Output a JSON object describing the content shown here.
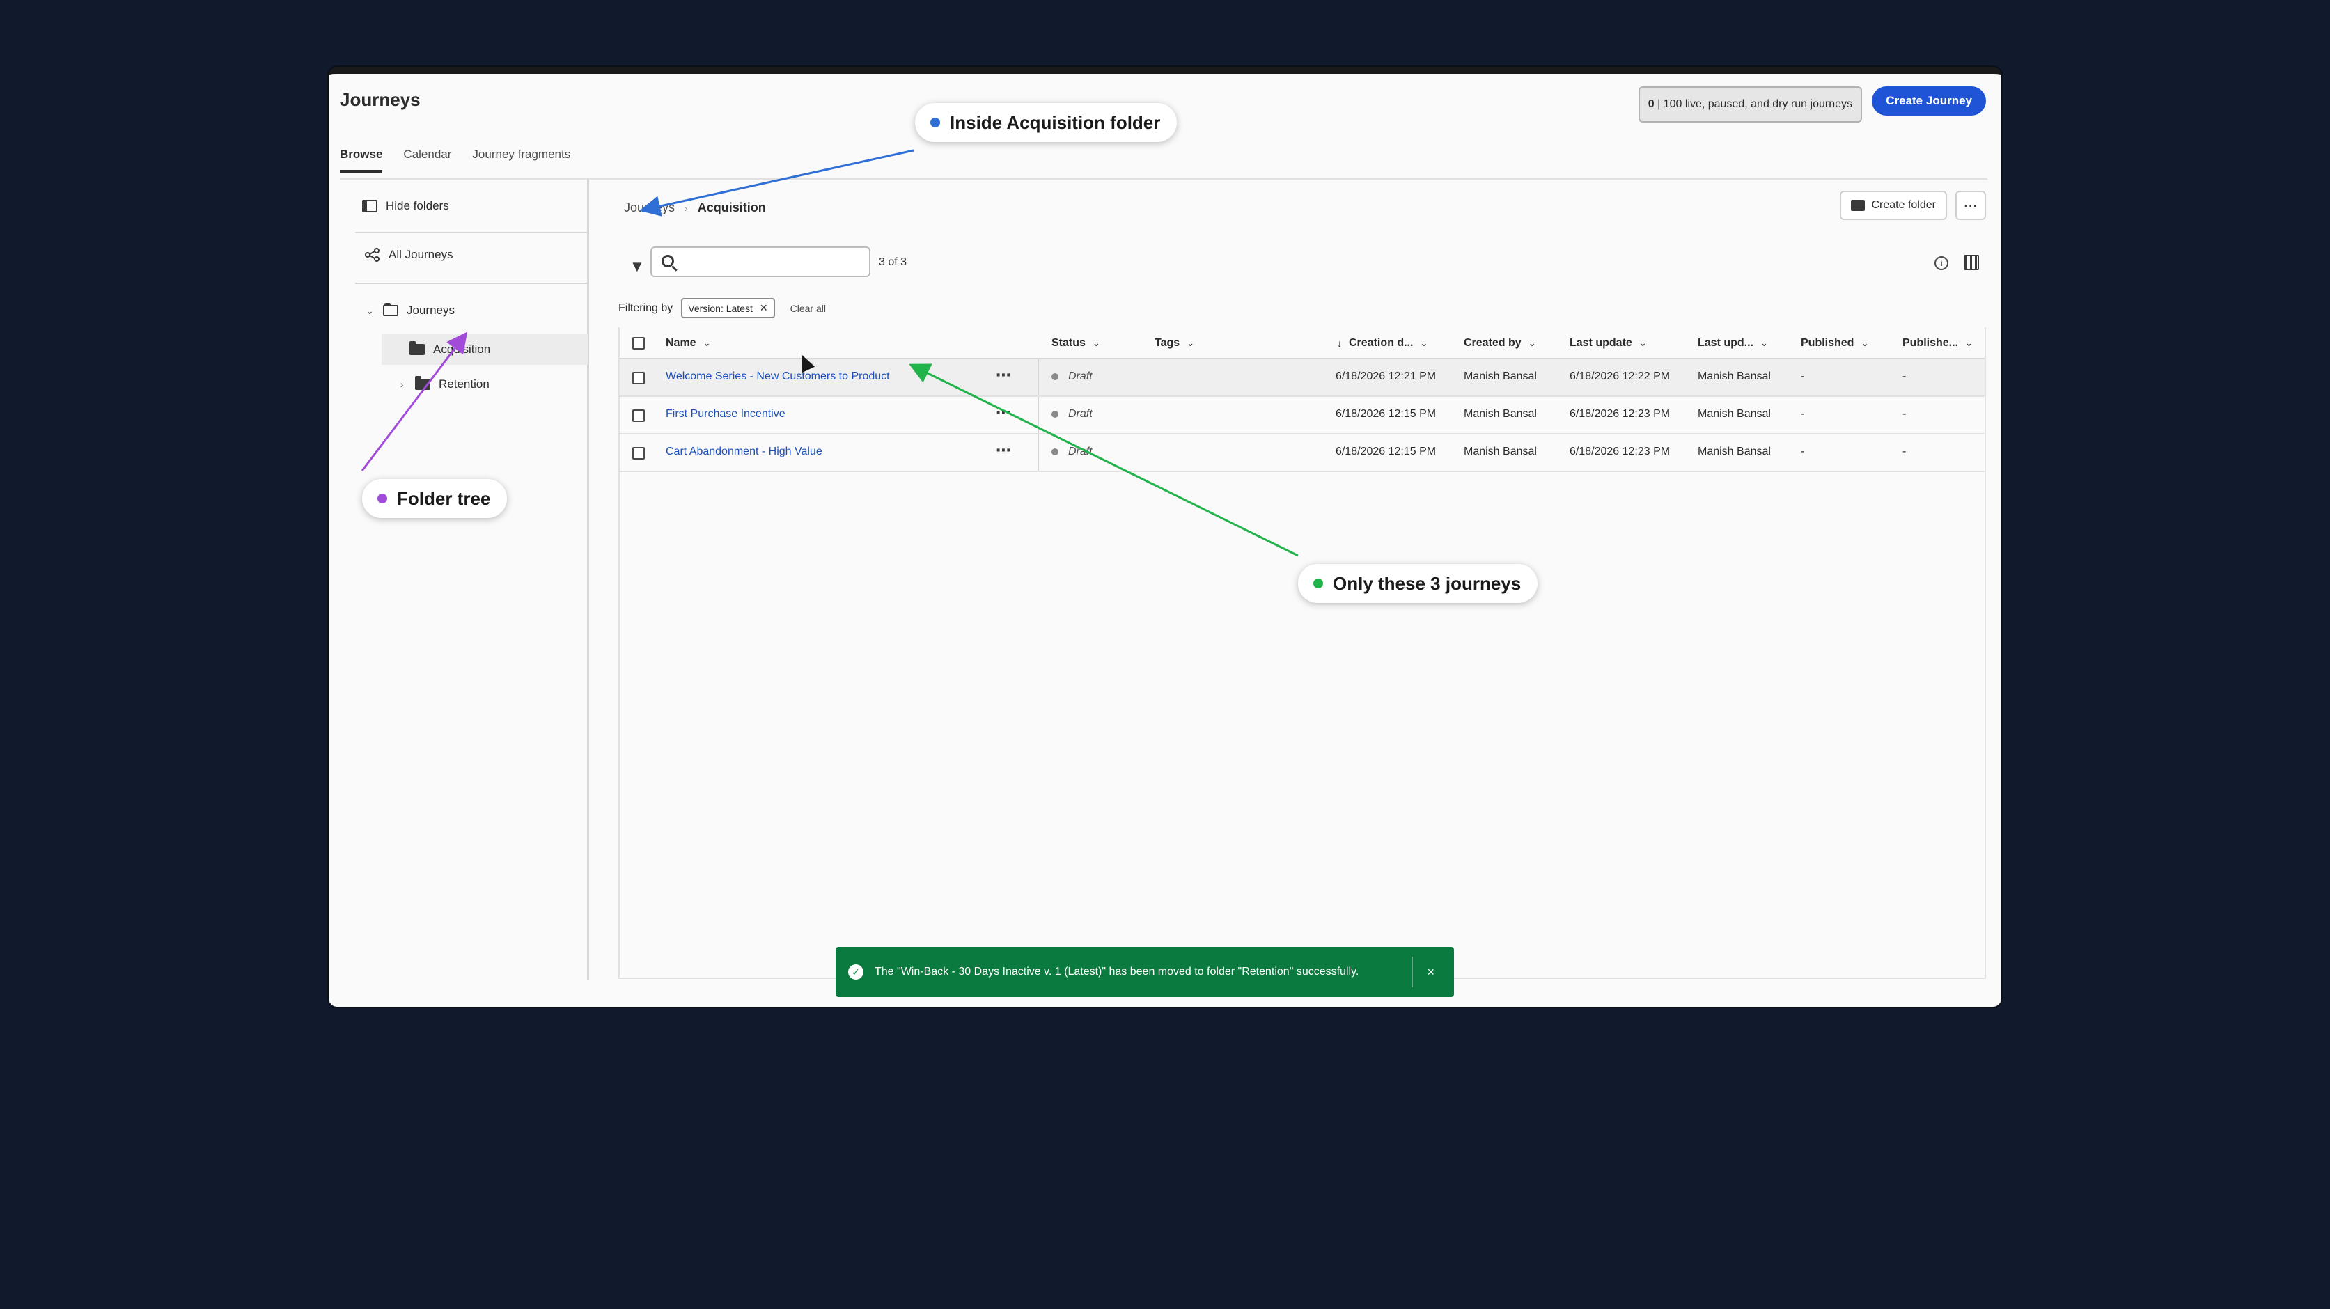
{
  "app": {
    "title": "Journeys"
  },
  "tabs": [
    {
      "label": "Browse",
      "active": true
    },
    {
      "label": "Calendar",
      "active": false
    },
    {
      "label": "Journey fragments",
      "active": false
    }
  ],
  "header": {
    "quota_count": "0",
    "quota_text": " | 100 live, paused, and dry run journeys",
    "create_journey_label": "Create Journey"
  },
  "sidebar": {
    "hide_folders_label": "Hide folders",
    "all_journeys_label": "All Journeys",
    "tree": [
      {
        "label": "Journeys",
        "expanded": true
      },
      {
        "label": "Acquisition",
        "selected": true
      },
      {
        "label": "Retention",
        "expanded": false
      }
    ]
  },
  "main": {
    "breadcrumb": [
      "Journeys",
      "Acquisition"
    ],
    "create_folder_label": "Create folder",
    "search_placeholder": "",
    "count": "3 of 3",
    "filtering_label": "Filtering by",
    "filter_chip": "Version: Latest",
    "clear_all_label": "Clear all"
  },
  "table": {
    "columns": [
      "Name",
      "Status",
      "Tags",
      "Creation d...",
      "Created by",
      "Last update",
      "Last upd...",
      "Published",
      "Publishe..."
    ],
    "rows": [
      {
        "name": "Welcome Series - New Customers to Product",
        "status": "Draft",
        "tags": "",
        "creation": "6/18/2026 12:21 PM",
        "created_by": "Manish Bansal",
        "last_update": "6/18/2026 12:22 PM",
        "last_updated_by": "Manish Bansal",
        "published": "-",
        "published_by": "-"
      },
      {
        "name": "First Purchase Incentive",
        "status": "Draft",
        "tags": "",
        "creation": "6/18/2026 12:15 PM",
        "created_by": "Manish Bansal",
        "last_update": "6/18/2026 12:23 PM",
        "last_updated_by": "Manish Bansal",
        "published": "-",
        "published_by": "-"
      },
      {
        "name": "Cart Abandonment - High Value",
        "status": "Draft",
        "tags": "",
        "creation": "6/18/2026 12:15 PM",
        "created_by": "Manish Bansal",
        "last_update": "6/18/2026 12:23 PM",
        "last_updated_by": "Manish Bansal",
        "published": "-",
        "published_by": "-"
      }
    ]
  },
  "toast": {
    "message": "The \"Win-Back - 30 Days Inactive v. 1 (Latest)\" has been moved to folder \"Retention\" successfully.",
    "close": "×"
  },
  "annotations": [
    {
      "label": "Inside Acquisition folder",
      "color": "#2f6fd6"
    },
    {
      "label": "Folder tree",
      "color": "#a24bd9"
    },
    {
      "label": "Only these 3 journeys",
      "color": "#22b34a"
    }
  ],
  "colors": {
    "accent": "#1f54d6",
    "link": "#1b4fba",
    "success": "#0b7a3e",
    "background": "#111a2c"
  }
}
